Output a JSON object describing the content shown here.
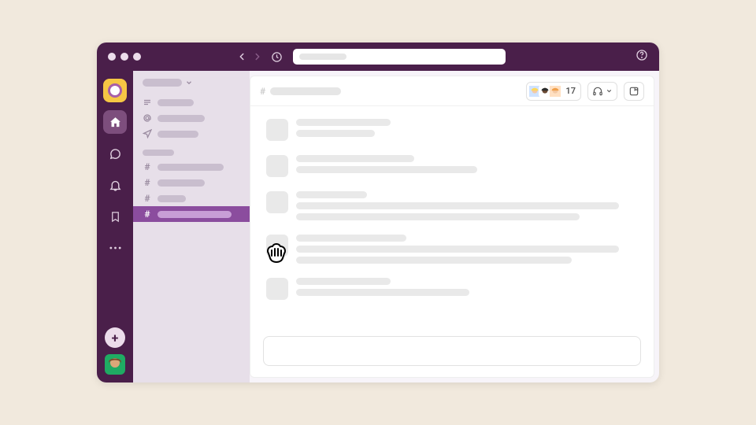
{
  "titlebar": {
    "search_placeholder": "",
    "nav": {
      "back": "‹",
      "forward": "›"
    }
  },
  "rail": {
    "items": [
      "home",
      "dms",
      "activity",
      "bookmarks",
      "more"
    ],
    "add_label": "+"
  },
  "sidebar": {
    "workspace_name": "",
    "nav": [
      {
        "icon": "threads",
        "width": 46
      },
      {
        "icon": "mentions",
        "width": 60
      },
      {
        "icon": "drafts",
        "width": 52
      }
    ],
    "channels": [
      {
        "selected": false,
        "width": 84
      },
      {
        "selected": false,
        "width": 60
      },
      {
        "selected": false,
        "width": 36
      },
      {
        "selected": true,
        "width": 94
      }
    ]
  },
  "channel_header": {
    "name": "",
    "member_count": "17",
    "avatars": [
      {
        "bg": "#cfe3ff",
        "hair": "#ffd95a",
        "skin": "#f3c9a5"
      },
      {
        "bg": "#fff",
        "hair": "#2b2b2b",
        "skin": "#6b4a35"
      },
      {
        "bg": "#ffe0c2",
        "hair": "#f0a04b",
        "skin": "#f3c9a5"
      }
    ]
  },
  "messages": [
    {
      "lines": [
        120,
        100
      ]
    },
    {
      "lines": [
        150,
        230
      ]
    },
    {
      "lines": [
        90,
        410,
        360
      ]
    },
    {
      "lines": [
        140,
        410,
        350
      ]
    },
    {
      "lines": [
        120,
        220
      ]
    }
  ],
  "user_avatar": {
    "bg": "#1fab63",
    "hair": "#7a4a2b",
    "skin": "#dba779"
  }
}
